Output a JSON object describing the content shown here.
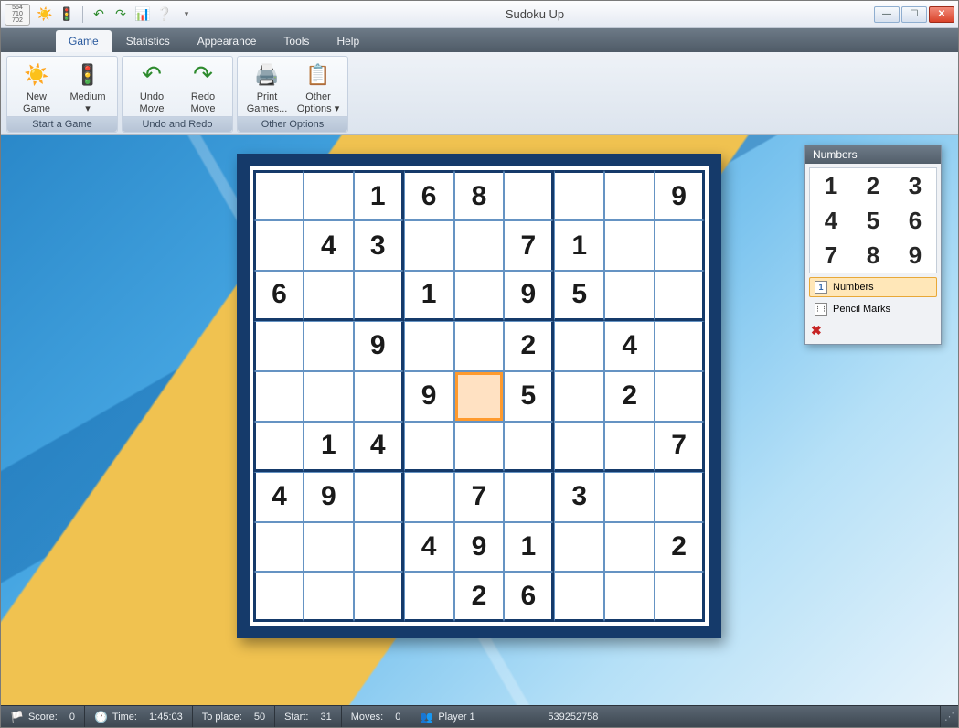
{
  "app": {
    "title": "Sudoku Up"
  },
  "tabs": [
    "Game",
    "Statistics",
    "Appearance",
    "Tools",
    "Help"
  ],
  "active_tab": 0,
  "ribbon": {
    "groups": [
      {
        "label": "Start a Game",
        "buttons": [
          {
            "label1": "New",
            "label2": "Game",
            "icon": "sun"
          },
          {
            "label1": "Medium",
            "label2": "",
            "icon": "traffic",
            "dropdown": true
          }
        ]
      },
      {
        "label": "Undo and Redo",
        "buttons": [
          {
            "label1": "Undo",
            "label2": "Move",
            "icon": "undo"
          },
          {
            "label1": "Redo",
            "label2": "Move",
            "icon": "redo"
          }
        ]
      },
      {
        "label": "Other Options",
        "buttons": [
          {
            "label1": "Print",
            "label2": "Games...",
            "icon": "print"
          },
          {
            "label1": "Other",
            "label2": "Options",
            "icon": "options",
            "dropdown": true
          }
        ]
      }
    ]
  },
  "palette": {
    "title": "Numbers",
    "numbers_label": "Numbers",
    "pencil_label": "Pencil Marks"
  },
  "status": {
    "score_label": "Score:",
    "score": "0",
    "time_label": "Time:",
    "time": "1:45:03",
    "toplace_label": "To place:",
    "toplace": "50",
    "start_label": "Start:",
    "start": "31",
    "moves_label": "Moves:",
    "moves": "0",
    "player": "Player 1",
    "gameid": "539252758"
  },
  "board": {
    "selected": [
      4,
      4
    ],
    "cells": [
      [
        "",
        "",
        "1",
        "6",
        "8",
        "",
        "",
        "",
        "9"
      ],
      [
        "",
        "4",
        "3",
        "",
        "",
        "7",
        "1",
        "",
        ""
      ],
      [
        "6",
        "",
        "",
        "1",
        "",
        "9",
        "5",
        "",
        ""
      ],
      [
        "",
        "",
        "9",
        "",
        "",
        "2",
        "",
        "4",
        ""
      ],
      [
        "",
        "",
        "",
        "9",
        "",
        "5",
        "",
        "2",
        ""
      ],
      [
        "",
        "1",
        "4",
        "",
        "",
        "",
        "",
        "",
        "7"
      ],
      [
        "4",
        "9",
        "",
        "",
        "7",
        "",
        "3",
        "",
        ""
      ],
      [
        "",
        "",
        "",
        "4",
        "9",
        "1",
        "",
        "",
        "2"
      ],
      [
        "",
        "",
        "",
        "",
        "2",
        "6",
        "",
        "",
        ""
      ]
    ]
  }
}
